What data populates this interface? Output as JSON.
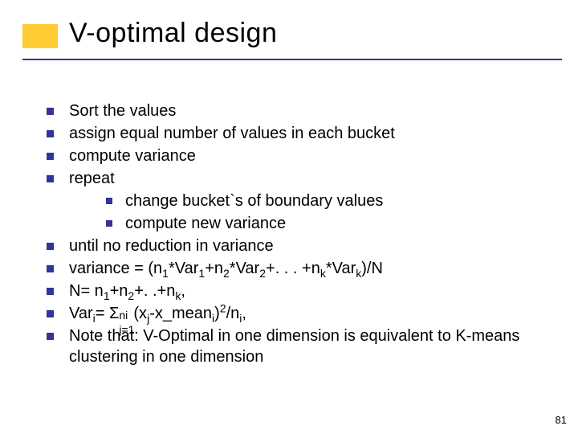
{
  "title": "V-optimal design",
  "bullets": [
    "Sort the values",
    "assign equal number of values in each bucket",
    "compute variance",
    "repeat",
    "until no reduction in variance"
  ],
  "sub_bullets": [
    "change bucket`s of boundary values",
    "compute new variance"
  ],
  "formula_variance_prefix": "variance = (n",
  "formula_variance_mid": "+. . . +n",
  "formula_variance_suffix": ")/N",
  "formula_n_prefix": "N= n",
  "formula_n_suffix": ",",
  "formula_vari_prefix": "Var",
  "formula_vari_eq": "= ",
  "sigma": "Σ",
  "formula_vari_inner_open": "(x",
  "formula_vari_inner_mid": "-x_mean",
  "formula_vari_inner_close": ")",
  "slash_n": "/n",
  "comma": ",",
  "note": "Note that: V-Optimal in one dimension is equivalent to K-means clustering in one dimension",
  "star_var": "*Var",
  "plus_n": "+n",
  "plus_dots": "+. .+n",
  "sub_1": "1",
  "sub_2": "2",
  "sub_k": "k",
  "sub_i": "i",
  "sub_j": "j",
  "sub_j1": "j=1",
  "sup_ni": "ni",
  "sup_2": "2",
  "page_number": "81"
}
